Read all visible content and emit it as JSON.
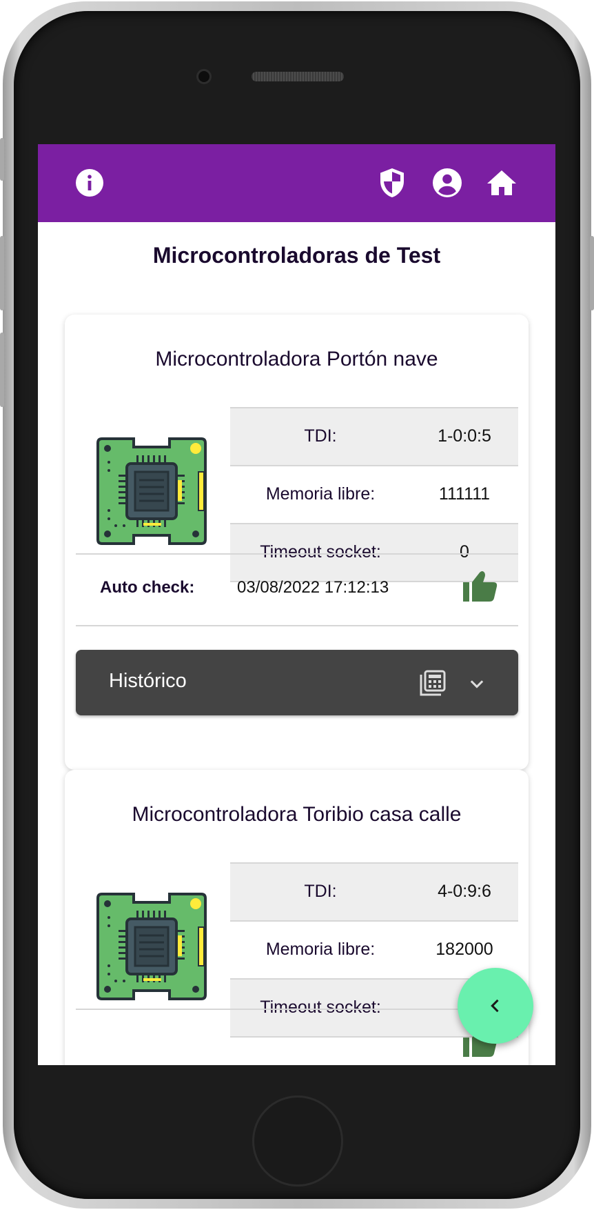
{
  "app": {
    "header_icons": [
      "info-icon",
      "shield-icon",
      "account-circle-icon",
      "home-icon"
    ],
    "colors": {
      "appbar": "#7b1fa2",
      "fab": "#69f0ae",
      "historico_bar": "#444444",
      "thumb": "#4a7c47"
    }
  },
  "page": {
    "title": "Microcontroladoras de Test"
  },
  "devices": [
    {
      "name": "Microcontroladora Portón nave",
      "rows": [
        {
          "label": "TDI:",
          "value": "1-0:0:5"
        },
        {
          "label": "Memoria libre:",
          "value": "111111"
        },
        {
          "label": "Timeout socket:",
          "value": "0"
        }
      ],
      "auto_check_label": "Auto check:",
      "auto_check_date": "03/08/2022 17:12:13",
      "auto_check_status": "thumb-up-icon",
      "historico_label": "Histórico"
    },
    {
      "name": "Microcontroladora Toribio casa calle",
      "rows": [
        {
          "label": "TDI:",
          "value": "4-0:9:6"
        },
        {
          "label": "Memoria libre:",
          "value": "182000"
        },
        {
          "label": "Timeout socket:",
          "value": ""
        }
      ]
    }
  ],
  "fab": {
    "icon": "chevron-left-icon"
  }
}
